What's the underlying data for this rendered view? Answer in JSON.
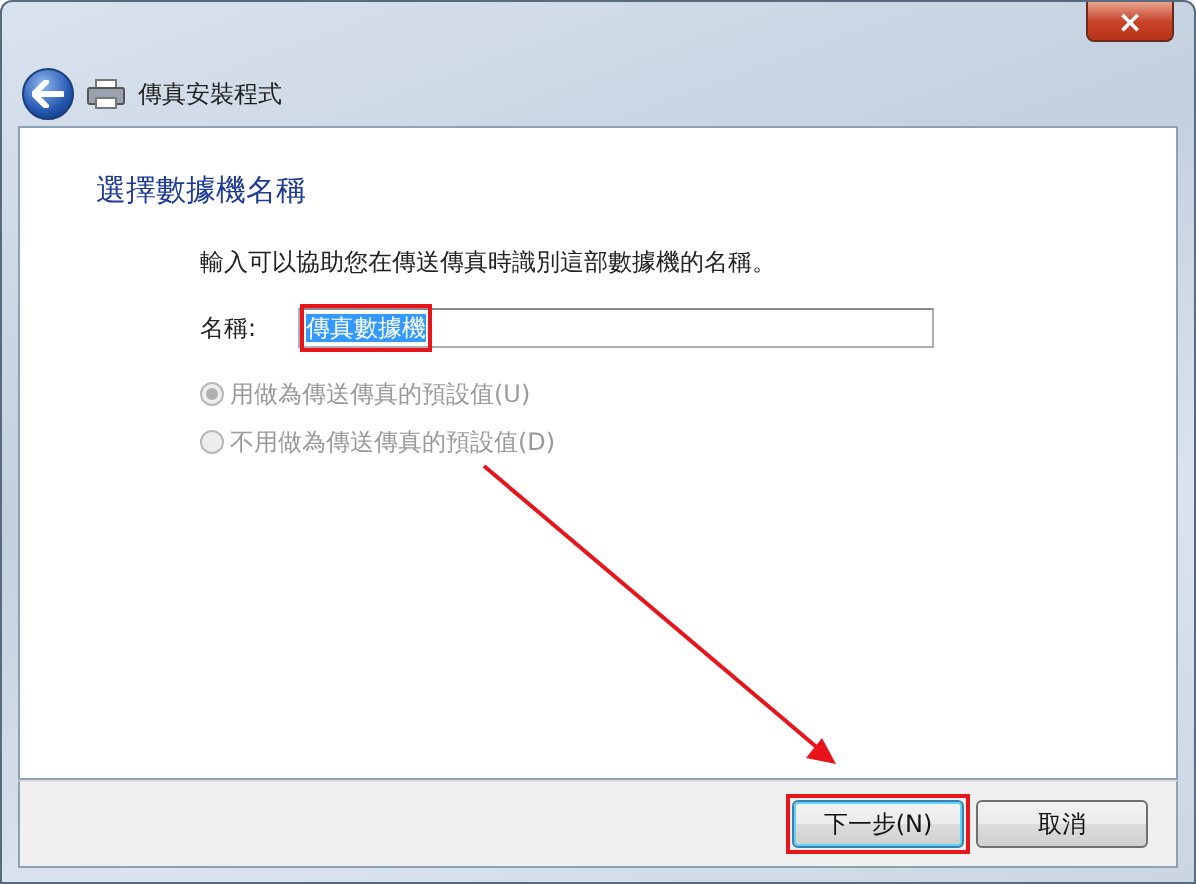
{
  "window": {
    "title": "傳真安裝程式",
    "close": "×"
  },
  "heading": "選擇數據機名稱",
  "description": "輸入可以協助您在傳送傳真時識別這部數據機的名稱。",
  "name_field": {
    "label": "名稱:",
    "value": "傳真數據機",
    "text_selected": true,
    "annotated": true
  },
  "options": [
    {
      "label": "用做為傳送傳真的預設值(U)",
      "selected": true,
      "disabled": true
    },
    {
      "label": "不用做為傳送傳真的預設值(D)",
      "selected": false,
      "disabled": true
    }
  ],
  "buttons": [
    {
      "label": "下一步(N)",
      "focused": true,
      "annotated": true
    },
    {
      "label": "取消",
      "focused": false,
      "annotated": false
    }
  ],
  "annotation_arrow": true
}
